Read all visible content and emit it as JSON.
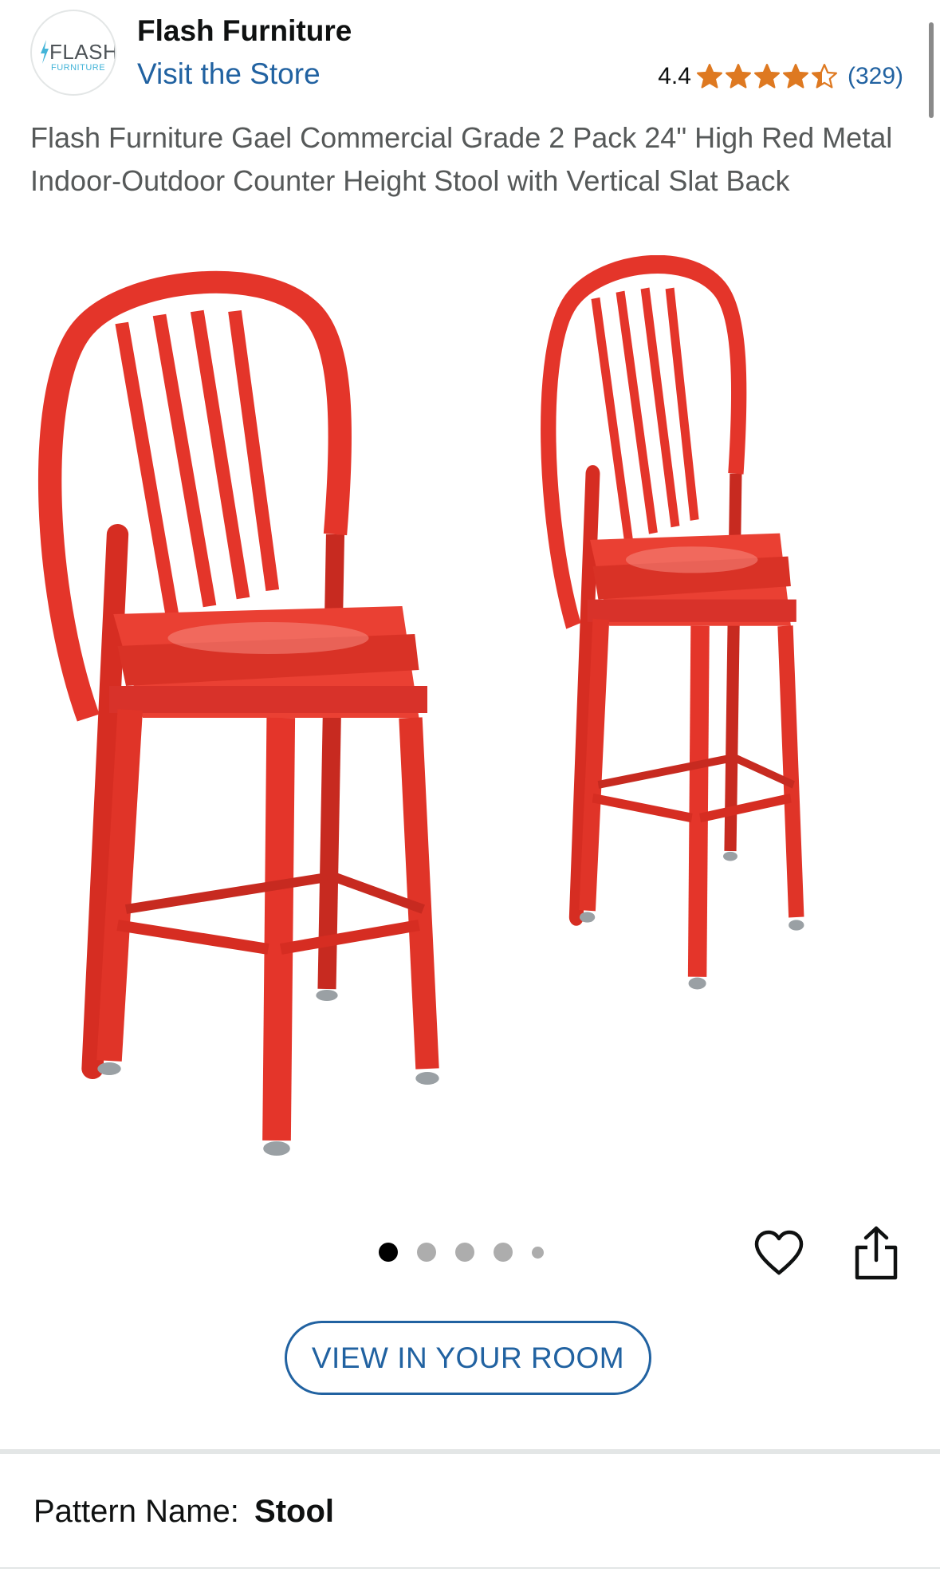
{
  "header": {
    "logo_text": "FLASH",
    "logo_subtext": "FURNITURE",
    "brand_name": "Flash Furniture",
    "visit_store": "Visit the Store",
    "rating_value": "4.4",
    "rating_stars": 4.4,
    "rating_count": "(329)"
  },
  "product": {
    "title": "Flash Furniture Gael Commercial Grade 2 Pack 24\" High Red Metal Indoor-Outdoor Counter Height Stool with Vertical Slat Back",
    "image_icon": "red-metal-bar-stools",
    "image_count": 5,
    "current_image": 1
  },
  "actions": {
    "view_in_room_label": "VIEW IN YOUR ROOM",
    "wishlist_icon": "heart-icon",
    "share_icon": "share-icon"
  },
  "variation": {
    "label": "Pattern Name:",
    "value": "Stool"
  },
  "colors": {
    "link": "#2162a1",
    "star": "#de7921",
    "text_secondary": "#565959",
    "stool_red": "#e4352a"
  }
}
